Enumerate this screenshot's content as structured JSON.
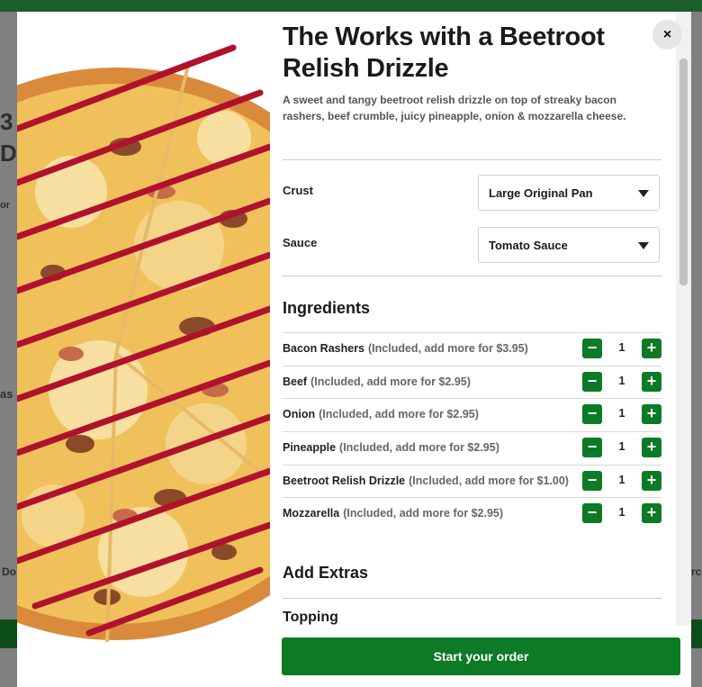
{
  "product": {
    "title": "The Works with a Beetroot Relish Drizzle",
    "description": "A sweet and tangy beetroot relish drizzle on top of streaky bacon rashers, beef crumble, juicy pineapple, onion & mozzarella cheese.",
    "image_alt": "Pizza with beetroot relish drizzle"
  },
  "options": [
    {
      "label": "Crust",
      "value": "Large Original Pan"
    },
    {
      "label": "Sauce",
      "value": "Tomato Sauce"
    }
  ],
  "ingredients": {
    "title": "Ingredients",
    "items": [
      {
        "name": "Bacon Rashers",
        "note": "(Included, add more for $3.95)",
        "qty": "1"
      },
      {
        "name": "Beef",
        "note": "(Included, add more for $2.95)",
        "qty": "1"
      },
      {
        "name": "Onion",
        "note": "(Included, add more for $2.95)",
        "qty": "1"
      },
      {
        "name": "Pineapple",
        "note": "(Included, add more for $2.95)",
        "qty": "1"
      },
      {
        "name": "Beetroot Relish Drizzle",
        "note": "(Included, add more for $1.00)",
        "qty": "1"
      },
      {
        "name": "Mozzarella",
        "note": "(Included, add more for $2.95)",
        "qty": "1"
      }
    ],
    "minus_symbol": "−",
    "plus_symbol": "+"
  },
  "extras": {
    "title": "Add Extras",
    "subsection": "Topping"
  },
  "close_symbol": "×",
  "cta_label": "Start your order",
  "colors": {
    "accent": "#0d7a25",
    "drizzle": "#b0122e"
  },
  "background_fragments": [
    "3",
    "D",
    "as",
    "or",
    "Do",
    "rc"
  ]
}
